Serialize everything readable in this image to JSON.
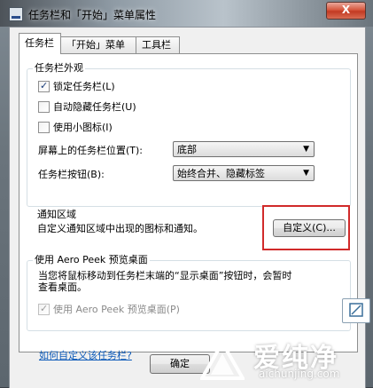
{
  "window": {
    "title": "任务栏和「开始」菜单属性",
    "close_label": "X"
  },
  "tabs": [
    {
      "label": "任务栏"
    },
    {
      "label": "「开始」菜单"
    },
    {
      "label": "工具栏"
    }
  ],
  "appearance": {
    "legend": "任务栏外观",
    "lock_label": "锁定任务栏(L)",
    "autohide_label": "自动隐藏任务栏(U)",
    "small_icons_label": "使用小图标(I)",
    "position_label": "屏幕上的任务栏位置(T):",
    "position_value": "底部",
    "buttons_label": "任务栏按钮(B):",
    "buttons_value": "始终合并、隐藏标签"
  },
  "notification": {
    "legend": "通知区域",
    "description": "自定义通知区域中出现的图标和通知。",
    "customize_label": "自定义(C)..."
  },
  "aero": {
    "legend": "使用 Aero Peek 预览桌面",
    "description_line1": "当您将鼠标移动到任务栏末端的“显示桌面”按钮时，会暂时",
    "description_line2": "查看桌面。",
    "checkbox_label": "使用 Aero Peek 预览桌面(P)"
  },
  "help_link": "如何自定义该任务栏?",
  "ok_label": "确定",
  "watermark": {
    "name": "爱纯净",
    "url": "aichunjing.com"
  }
}
